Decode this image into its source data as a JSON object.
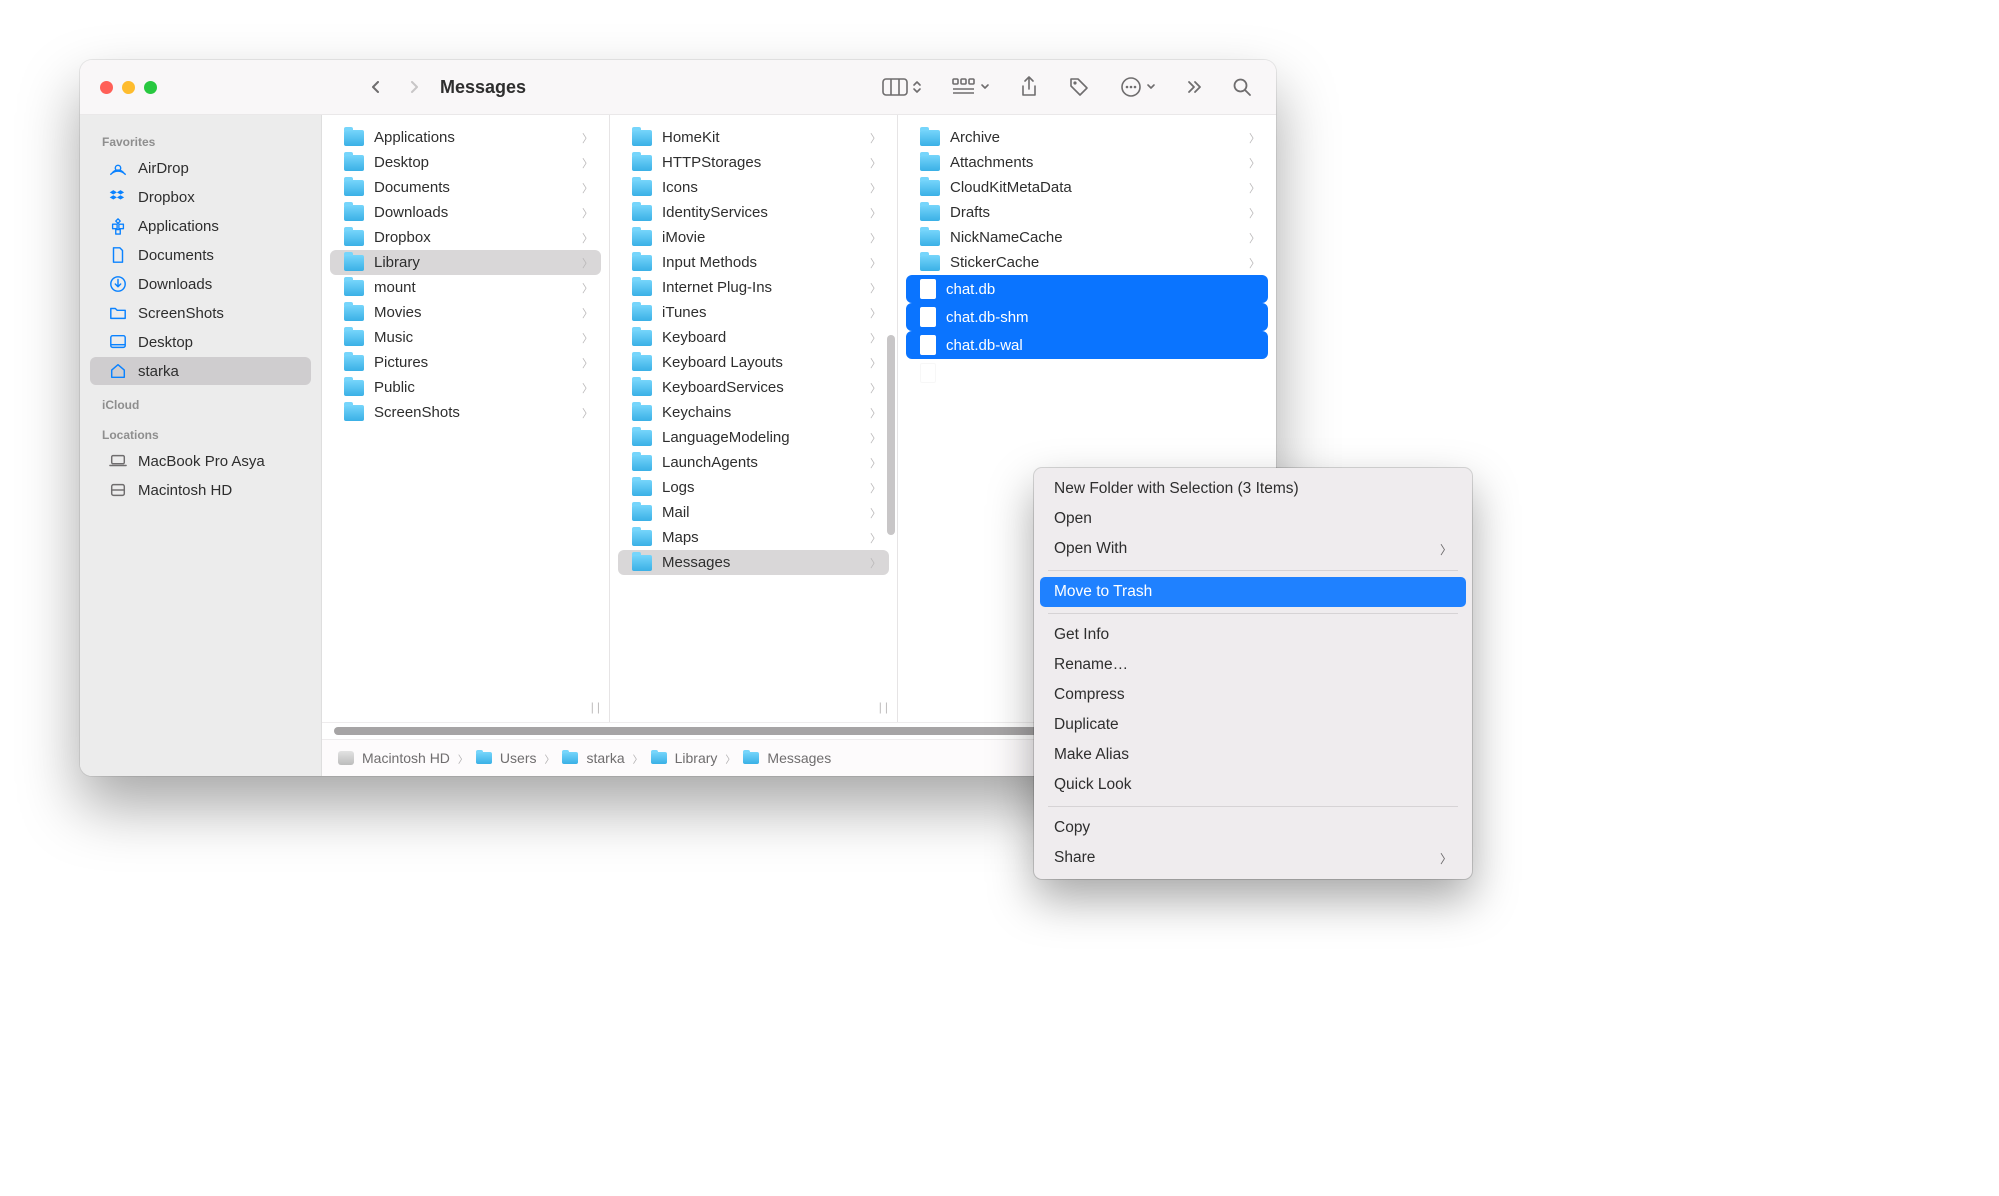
{
  "window": {
    "title": "Messages"
  },
  "sidebar": {
    "sections": [
      {
        "heading": "Favorites",
        "items": [
          {
            "icon": "airdrop",
            "label": "AirDrop"
          },
          {
            "icon": "dropbox",
            "label": "Dropbox"
          },
          {
            "icon": "apps",
            "label": "Applications"
          },
          {
            "icon": "doc",
            "label": "Documents"
          },
          {
            "icon": "down",
            "label": "Downloads"
          },
          {
            "icon": "folder",
            "label": "ScreenShots"
          },
          {
            "icon": "desktop",
            "label": "Desktop"
          },
          {
            "icon": "home",
            "label": "starka",
            "selected": true
          }
        ]
      },
      {
        "heading": "iCloud",
        "items": []
      },
      {
        "heading": "Locations",
        "items": [
          {
            "icon": "laptop",
            "label": "MacBook Pro Asya",
            "gray": true
          },
          {
            "icon": "disk",
            "label": "Macintosh HD",
            "gray": true
          }
        ]
      }
    ]
  },
  "columns": [
    {
      "items": [
        {
          "type": "folder",
          "label": "Applications"
        },
        {
          "type": "folder",
          "label": "Desktop"
        },
        {
          "type": "folder",
          "label": "Documents"
        },
        {
          "type": "folder",
          "label": "Downloads"
        },
        {
          "type": "folder",
          "label": "Dropbox"
        },
        {
          "type": "folder",
          "label": "Library",
          "selected": "gray"
        },
        {
          "type": "folder",
          "label": "mount"
        },
        {
          "type": "folder",
          "label": "Movies"
        },
        {
          "type": "folder",
          "label": "Music"
        },
        {
          "type": "folder",
          "label": "Pictures"
        },
        {
          "type": "folder",
          "label": "Public"
        },
        {
          "type": "folder",
          "label": "ScreenShots"
        }
      ]
    },
    {
      "scrollbar": true,
      "items": [
        {
          "type": "folder",
          "label": "HomeKit"
        },
        {
          "type": "folder",
          "label": "HTTPStorages"
        },
        {
          "type": "folder",
          "label": "Icons"
        },
        {
          "type": "folder",
          "label": "IdentityServices"
        },
        {
          "type": "folder",
          "label": "iMovie"
        },
        {
          "type": "folder",
          "label": "Input Methods"
        },
        {
          "type": "folder",
          "label": "Internet Plug-Ins"
        },
        {
          "type": "folder",
          "label": "iTunes"
        },
        {
          "type": "folder",
          "label": "Keyboard"
        },
        {
          "type": "folder",
          "label": "Keyboard Layouts"
        },
        {
          "type": "folder",
          "label": "KeyboardServices"
        },
        {
          "type": "folder",
          "label": "Keychains"
        },
        {
          "type": "folder",
          "label": "LanguageModeling"
        },
        {
          "type": "folder",
          "label": "LaunchAgents"
        },
        {
          "type": "folder",
          "label": "Logs"
        },
        {
          "type": "folder",
          "label": "Mail"
        },
        {
          "type": "folder",
          "label": "Maps"
        },
        {
          "type": "folder",
          "label": "Messages",
          "selected": "gray"
        }
      ]
    },
    {
      "items": [
        {
          "type": "folder",
          "label": "Archive"
        },
        {
          "type": "folder",
          "label": "Attachments"
        },
        {
          "type": "folder",
          "label": "CloudKitMetaData"
        },
        {
          "type": "folder",
          "label": "Drafts"
        },
        {
          "type": "folder",
          "label": "NickNameCache"
        },
        {
          "type": "folder",
          "label": "StickerCache"
        },
        {
          "type": "file",
          "label": "chat.db",
          "selected": "blue"
        },
        {
          "type": "file",
          "label": "chat.db-shm",
          "selected": "blue"
        },
        {
          "type": "file",
          "label": "chat.db-wal",
          "selected": "blue"
        },
        {
          "type": "file",
          "label": "",
          "dim": true
        }
      ]
    }
  ],
  "path": [
    {
      "icon": "disk",
      "label": "Macintosh HD"
    },
    {
      "icon": "folder",
      "label": "Users"
    },
    {
      "icon": "folder",
      "label": "starka"
    },
    {
      "icon": "folder",
      "label": "Library"
    },
    {
      "icon": "folder",
      "label": "Messages"
    }
  ],
  "context_menu": {
    "items": [
      {
        "label": "New Folder with Selection (3 Items)"
      },
      {
        "label": "Open"
      },
      {
        "label": "Open With",
        "submenu": true
      },
      {
        "sep": true
      },
      {
        "label": "Move to Trash",
        "hover": true
      },
      {
        "sep": true
      },
      {
        "label": "Get Info"
      },
      {
        "label": "Rename…"
      },
      {
        "label": "Compress"
      },
      {
        "label": "Duplicate"
      },
      {
        "label": "Make Alias"
      },
      {
        "label": "Quick Look"
      },
      {
        "sep": true
      },
      {
        "label": "Copy"
      },
      {
        "label": "Share",
        "submenu": true
      }
    ]
  }
}
